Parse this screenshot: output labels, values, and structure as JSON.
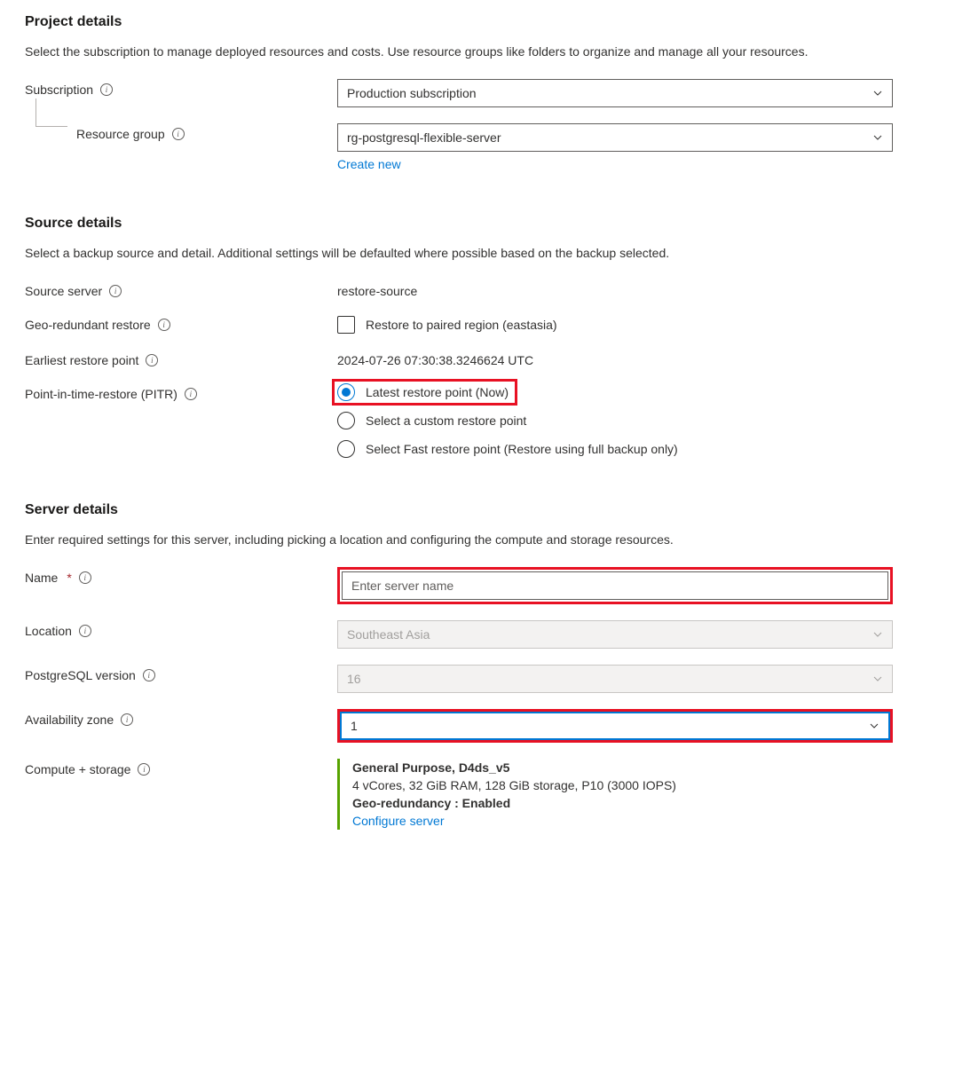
{
  "project": {
    "heading": "Project details",
    "desc": "Select the subscription to manage deployed resources and costs. Use resource groups like folders to organize and manage all your resources.",
    "subscription_label": "Subscription",
    "subscription_value": "Production subscription",
    "resource_group_label": "Resource group",
    "resource_group_value": "rg-postgresql-flexible-server",
    "create_new": "Create new"
  },
  "source": {
    "heading": "Source details",
    "desc": "Select a backup source and detail. Additional settings will be defaulted where possible based on the backup selected.",
    "source_server_label": "Source server",
    "source_server_value": "restore-source",
    "geo_label": "Geo-redundant restore",
    "geo_checkbox_text": "Restore to paired region (eastasia)",
    "earliest_label": "Earliest restore point",
    "earliest_value": "2024-07-26 07:30:38.3246624 UTC",
    "pitr_label": "Point-in-time-restore (PITR)",
    "pitr_options": [
      "Latest restore point (Now)",
      "Select a custom restore point",
      "Select Fast restore point (Restore using full backup only)"
    ]
  },
  "server": {
    "heading": "Server details",
    "desc": "Enter required settings for this server, including picking a location and configuring the compute and storage resources.",
    "name_label": "Name",
    "name_placeholder": "Enter server name",
    "location_label": "Location",
    "location_value": "Southeast Asia",
    "pg_version_label": "PostgreSQL version",
    "pg_version_value": "16",
    "az_label": "Availability zone",
    "az_value": "1",
    "compute_label": "Compute + storage",
    "compute_title": "General Purpose, D4ds_v5",
    "compute_spec": "4 vCores, 32 GiB RAM, 128 GiB storage, P10 (3000 IOPS)",
    "compute_geo": "Geo-redundancy : Enabled",
    "configure_link": "Configure server"
  }
}
